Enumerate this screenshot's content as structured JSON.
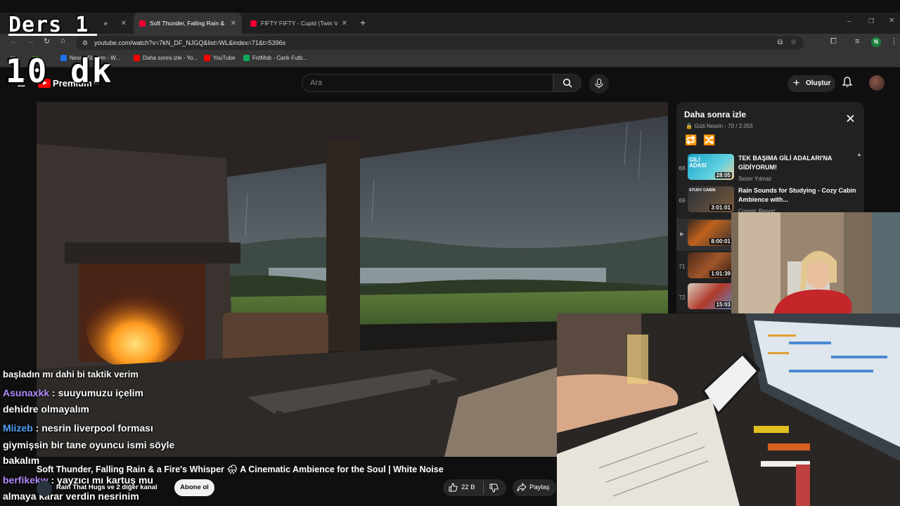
{
  "overlay": {
    "lesson": "Ders 1",
    "timer": "10 dk"
  },
  "tabs": [
    {
      "label": "e",
      "active": false
    },
    {
      "label": "Soft Thunder, Falling Rain & a F",
      "active": true
    },
    {
      "label": "FIFTY FIFTY - Cupid (Twin Versic",
      "active": false
    }
  ],
  "address": {
    "url": "youtube.com/watch?v=7kN_DF_NJGQ&list=WL&index=71&t=5396s"
  },
  "bookmarks": [
    {
      "label": "Nesrin Stream - W...",
      "color": "#1a73e8"
    },
    {
      "label": "Daha sonra izle - Yo...",
      "color": "#ff0000"
    },
    {
      "label": "YouTube",
      "color": "#ff0000"
    },
    {
      "label": "FotMob - Canlı Futb...",
      "color": "#0fa958"
    }
  ],
  "youtube": {
    "logo": "Premium",
    "logo_region": "TR",
    "search_placeholder": "Ara",
    "create_label": "Oluştur"
  },
  "playlist": {
    "title": "Daha sonra izle",
    "subtitle": "Gizli  Nesrin - 70 / 2.055",
    "items": [
      {
        "num": "68",
        "title": "TEK BAŞIMA GİLİ ADALARI'NA GİDİYORUM!",
        "channel": "Sezer Yılmaz",
        "duration": "28:05",
        "thumb_text": "GİLİ ADASI"
      },
      {
        "num": "69",
        "title": "Rain Sounds for Studying - Cozy Cabin Ambience with...",
        "channel": "Cosmic Resort",
        "duration": "3:01:01",
        "thumb_text": "STUDY CABIN"
      },
      {
        "num": "▶",
        "title": "",
        "channel": "",
        "duration": "8:00:01",
        "thumb_text": ""
      },
      {
        "num": "71",
        "title": "",
        "channel": "",
        "duration": "1:01:39",
        "thumb_text": ""
      },
      {
        "num": "72",
        "title": "",
        "channel": "",
        "duration": "15:03",
        "thumb_text": ""
      }
    ]
  },
  "chat": [
    {
      "user": "",
      "message": "başladın mı dahi bi taktik verim",
      "color": "#ffffff"
    },
    {
      "user": "Asunaxkk",
      "message": " : suuyumuzu içelim",
      "color": "#b48cff"
    },
    {
      "user": "",
      "message": "dehidre olmayalım",
      "color": "#ffffff"
    },
    {
      "user": "Miizeb",
      "message": " : nesrin liverpool forması",
      "color": "#4fa3ff"
    },
    {
      "user": "",
      "message": "giymişsin bir tane oyuncu ismi söyle",
      "color": "#ffffff"
    },
    {
      "user": "",
      "message": "bakalım",
      "color": "#ffffff"
    },
    {
      "user": "berfikekw",
      "message": " : yayzıcı mı kartuş mu",
      "color": "#b48cff"
    },
    {
      "user": "",
      "message": "almaya karar verdin nesrinim",
      "color": "#ffffff"
    }
  ],
  "video": {
    "title": "Soft Thunder, Falling Rain & a Fire's Whisper 🌧 A Cinematic Ambience for the Soul | White Noise",
    "channel": "Rain That Hugs ve 2 diğer kanal",
    "subscribe_label": "Abone ol",
    "likes": "22 B",
    "share_label": "Paylaş"
  }
}
